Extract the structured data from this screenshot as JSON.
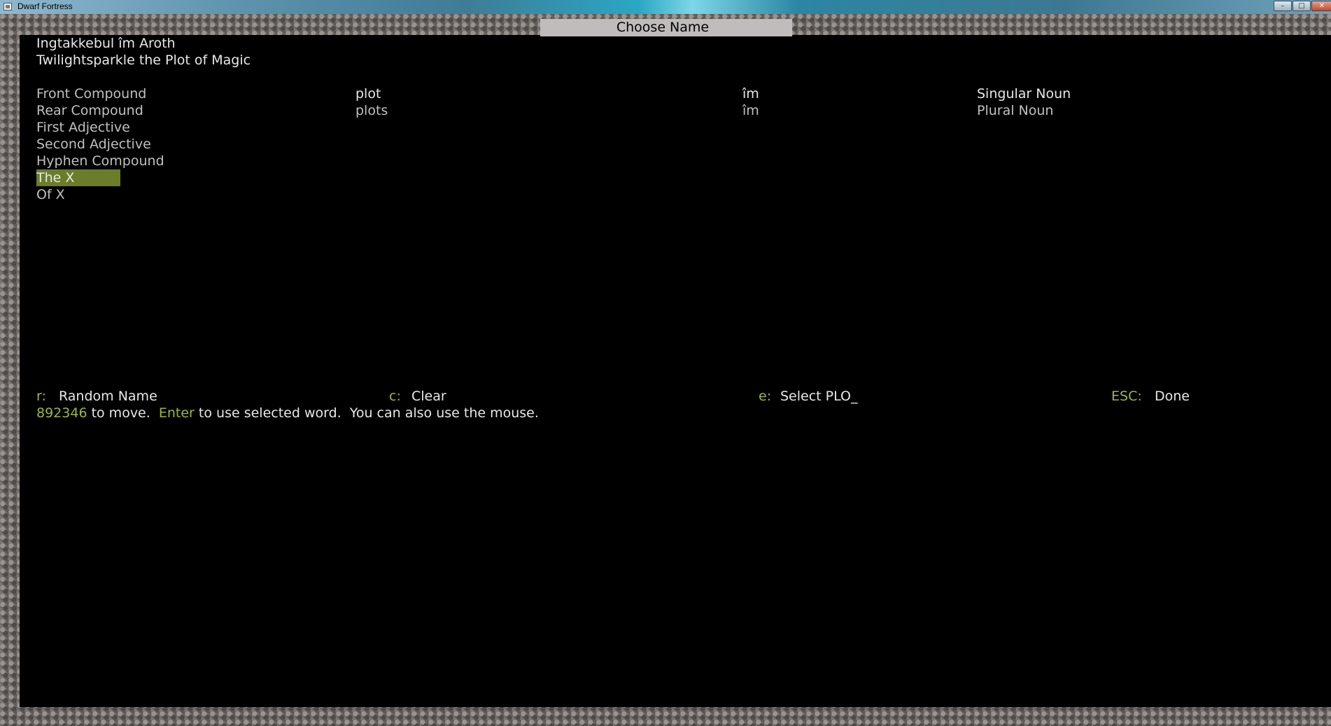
{
  "window": {
    "title": "Dwarf Fortress",
    "minimize": "–",
    "maximize": "□",
    "close": "✕"
  },
  "screen_title": "Choose Name",
  "name": {
    "native": "Ingtakkebul îm Aroth",
    "translated": "Twilightsparkle the Plot of Magic"
  },
  "name_parts": [
    "Front Compound",
    "Rear Compound",
    "First Adjective",
    "Second Adjective",
    "Hyphen Compound",
    "The X",
    "Of X"
  ],
  "selected_part": "The X",
  "word_list": [
    {
      "english": "plot",
      "native": "îm",
      "form": "Singular Noun"
    },
    {
      "english": "plots",
      "native": "îm",
      "form": "Plural Noun"
    }
  ],
  "commands": {
    "random": {
      "key": "r:",
      "label": "Random Name"
    },
    "clear": {
      "key": "c:",
      "label": "Clear"
    },
    "select": {
      "key": "e:",
      "label": "Select PLO_"
    },
    "done": {
      "key": "ESC:",
      "label": "Done"
    }
  },
  "help": {
    "keys": "892346",
    "move": " to move.  ",
    "enter": "Enter",
    "rest": " to use selected word.  You can also use the mouse."
  },
  "colors": {
    "highlight_key": "#9cb83a",
    "selected_bg": "#6b7d2a",
    "title_bg": "#c0bcbc"
  }
}
